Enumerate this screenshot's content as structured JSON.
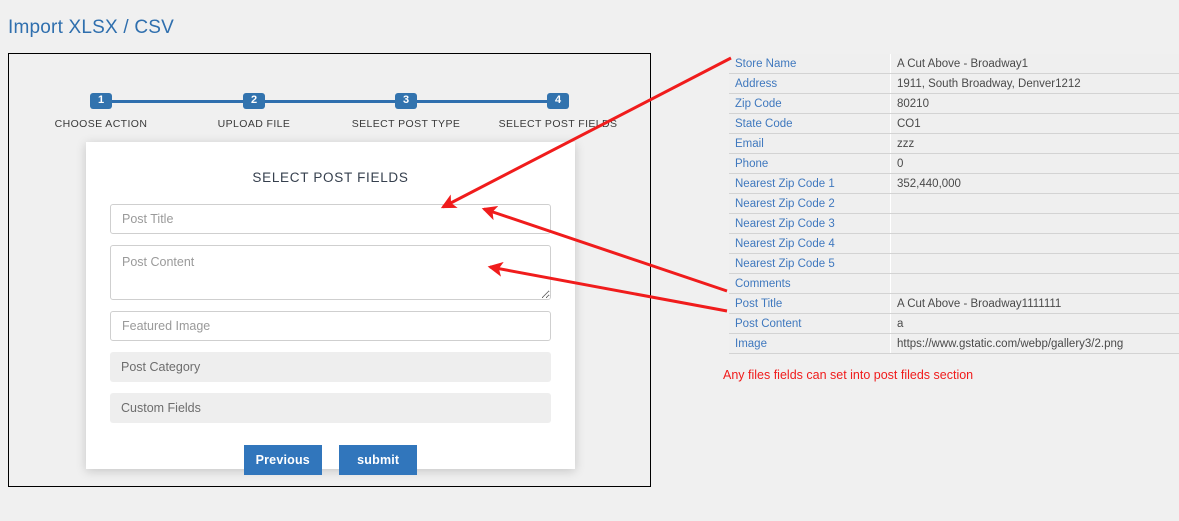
{
  "page": {
    "title": "Import XLSX / CSV"
  },
  "stepper": {
    "steps": [
      {
        "number": "1",
        "label": "CHOOSE ACTION"
      },
      {
        "number": "2",
        "label": "UPLOAD FILE"
      },
      {
        "number": "3",
        "label": "SELECT POST TYPE"
      },
      {
        "number": "4",
        "label": "SELECT POST FIELDS"
      }
    ],
    "accent_color": "#3273ae"
  },
  "card": {
    "title": "SELECT POST FIELDS",
    "fields": {
      "post_title_placeholder": "Post Title",
      "post_title_value": "",
      "post_content_placeholder": "Post Content",
      "post_content_value": "",
      "featured_image_placeholder": "Featured Image",
      "featured_image_value": "",
      "post_category_label": "Post Category",
      "custom_fields_label": "Custom Fields"
    },
    "buttons": {
      "previous_label": "Previous",
      "submit_label": "submit",
      "color": "#3176bc"
    }
  },
  "data_table": {
    "rows": [
      {
        "label": "Store Name",
        "value": "A Cut Above - Broadway1"
      },
      {
        "label": "Address",
        "value": "1911, South Broadway, Denver1212"
      },
      {
        "label": "Zip Code",
        "value": "80210"
      },
      {
        "label": "State Code",
        "value": "CO1"
      },
      {
        "label": "Email",
        "value": "zzz"
      },
      {
        "label": "Phone",
        "value": "0"
      },
      {
        "label": "Nearest Zip Code 1",
        "value": "352,440,000"
      },
      {
        "label": "Nearest Zip Code 2",
        "value": ""
      },
      {
        "label": "Nearest Zip Code 3",
        "value": ""
      },
      {
        "label": "Nearest Zip Code 4",
        "value": ""
      },
      {
        "label": "Nearest Zip Code 5",
        "value": ""
      },
      {
        "label": "Comments",
        "value": ""
      },
      {
        "label": "Post Title",
        "value": "A Cut Above - Broadway1111111"
      },
      {
        "label": "Post Content",
        "value": "a"
      },
      {
        "label": "Image",
        "value": "https://www.gstatic.com/webp/gallery3/2.png"
      }
    ],
    "label_color": "#3f78be"
  },
  "annotations": {
    "note": "Any files fields can set into post fileds section",
    "color": "#f01c1c"
  }
}
